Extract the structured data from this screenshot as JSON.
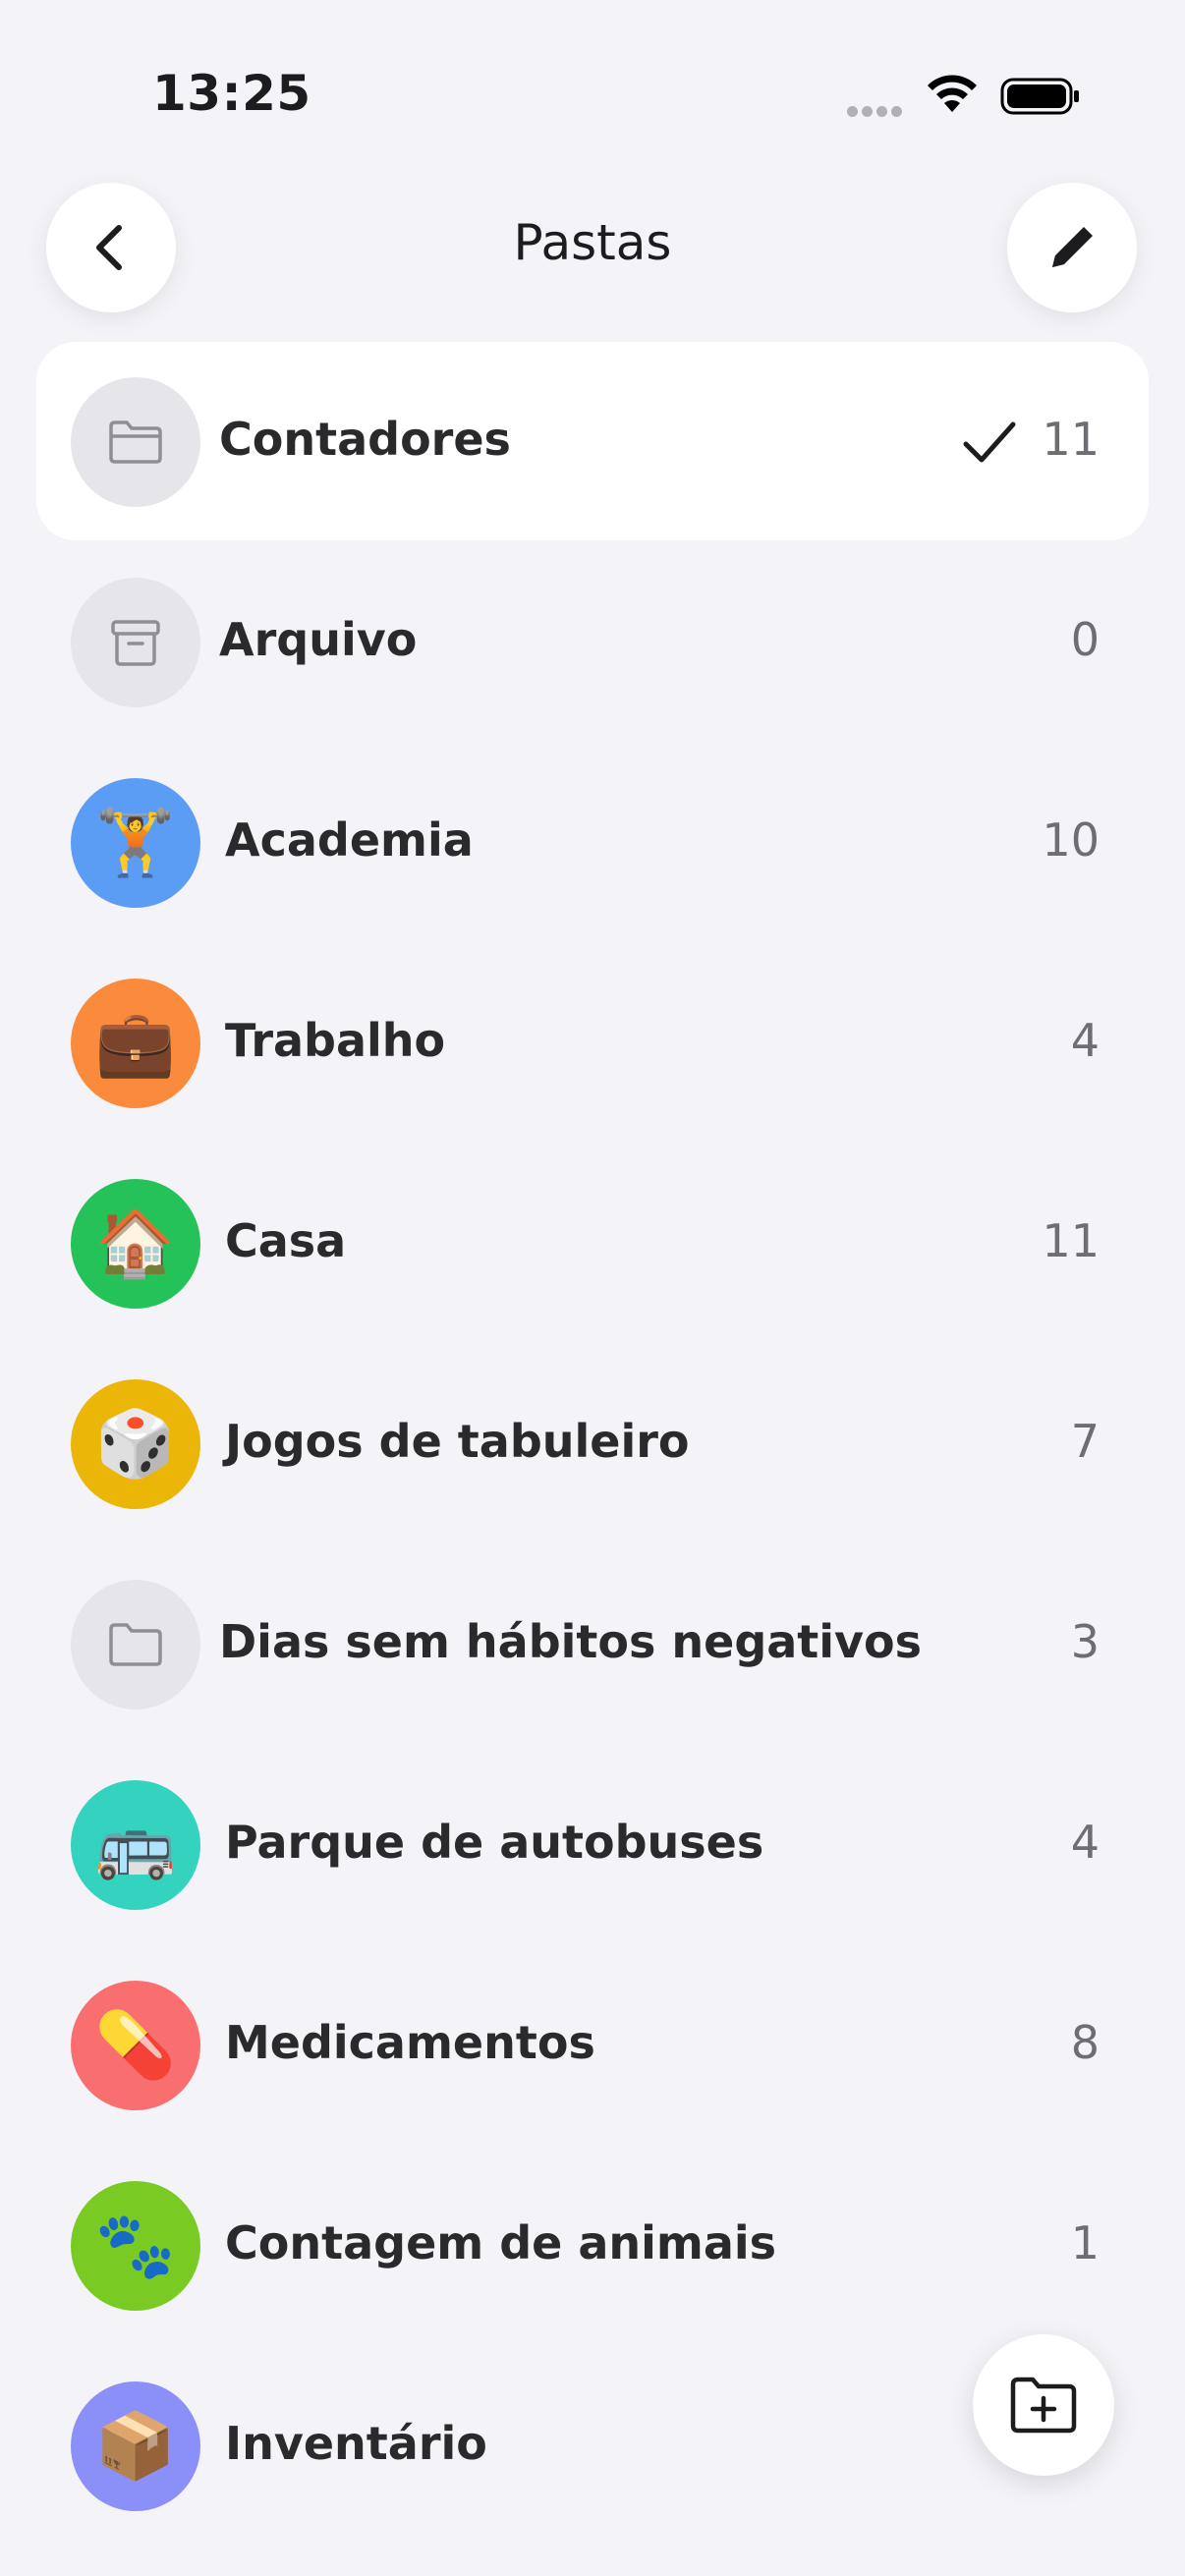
{
  "status_bar": {
    "time": "13:25"
  },
  "nav": {
    "title": "Pastas",
    "back_icon": "chevron-left-icon",
    "edit_icon": "pencil-icon"
  },
  "folders": [
    {
      "label": "Contadores",
      "count": "11",
      "icon": "folder-icon",
      "selected": true
    },
    {
      "label": "Arquivo",
      "count": "0",
      "icon": "archive-box-icon"
    },
    {
      "label": "Academia",
      "count": "10",
      "icon": "weightlifter-emoji",
      "emoji": "🏋️",
      "color": "#5b9cf5"
    },
    {
      "label": "Trabalho",
      "count": "4",
      "icon": "briefcase-emoji",
      "emoji": "💼",
      "color": "#fb8b3c"
    },
    {
      "label": "Casa",
      "count": "11",
      "icon": "house-emoji",
      "emoji": "🏠",
      "color": "#24c259"
    },
    {
      "label": "Jogos de tabuleiro",
      "count": "7",
      "icon": "die-emoji",
      "emoji": "🎲",
      "color": "#ebb607"
    },
    {
      "label": "Dias sem hábitos negativos",
      "count": "3",
      "icon": "folder-icon"
    },
    {
      "label": "Parque de autobuses",
      "count": "4",
      "icon": "bus-emoji",
      "emoji": "🚌",
      "color": "#33d3c0"
    },
    {
      "label": "Medicamentos",
      "count": "8",
      "icon": "pill-emoji",
      "emoji": "💊",
      "color": "#f96f6f"
    },
    {
      "label": "Contagem de animais",
      "count": "1",
      "icon": "paw-prints-emoji",
      "emoji": "🐾",
      "color": "#79cb23"
    },
    {
      "label": "Inventário",
      "count": "",
      "icon": "package-emoji",
      "emoji": "📦",
      "color": "#8a90f7"
    }
  ],
  "fab": {
    "icon": "folder-add-icon"
  },
  "colors": {
    "background": "#f4f4f8",
    "neutral_icon_bg": "#e6e6ea",
    "selected_row_bg": "#ffffff"
  }
}
